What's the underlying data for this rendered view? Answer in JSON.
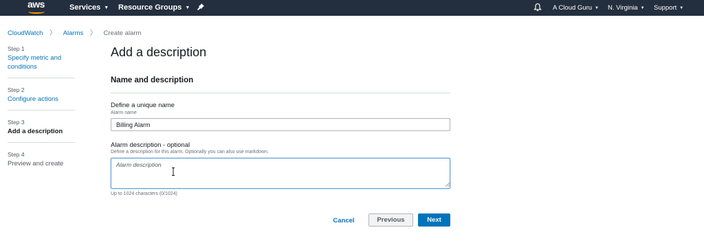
{
  "nav": {
    "logo_text": "aws",
    "services": "Services",
    "resource_groups": "Resource Groups",
    "account": "A Cloud Guru",
    "region": "N. Virginia",
    "support": "Support",
    "caret": "▼"
  },
  "breadcrumb": {
    "items": [
      "CloudWatch",
      "Alarms",
      "Create alarm"
    ],
    "separator": "〉"
  },
  "steps": [
    {
      "number": "Step 1",
      "title": "Specify metric and conditions",
      "state": "link"
    },
    {
      "number": "Step 2",
      "title": "Configure actions",
      "state": "link"
    },
    {
      "number": "Step 3",
      "title": "Add a description",
      "state": "active"
    },
    {
      "number": "Step 4",
      "title": "Preview and create",
      "state": "disabled"
    }
  ],
  "main": {
    "title": "Add a description",
    "section_title": "Name and description",
    "name_field": {
      "label": "Define a unique name",
      "sublabel": "Alarm name",
      "value": "Billing Alarm"
    },
    "description_field": {
      "label": "Alarm description - optional",
      "sublabel": "Define a description for this alarm. Optionally you can also use markdown.",
      "placeholder": "Alarm description",
      "hint": "Up to 1024 characters (0/1024)"
    }
  },
  "buttons": {
    "cancel": "Cancel",
    "previous": "Previous",
    "next": "Next"
  },
  "colors": {
    "nav_bg": "#232f3e",
    "link": "#0073bb",
    "primary_button": "#0073bb",
    "logo_accent": "#ff9900"
  },
  "icons": [
    "aws-logo",
    "pin-icon",
    "bell-icon",
    "chevron-right-icon",
    "text-cursor-icon",
    "resize-grip-icon"
  ]
}
